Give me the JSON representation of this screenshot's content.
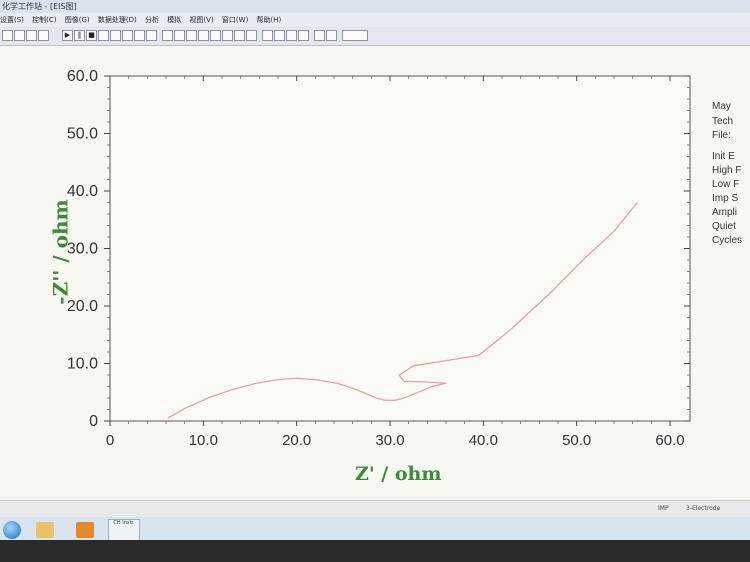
{
  "window": {
    "title": "化学工作站 - [EIS图]",
    "menus": [
      "设置(S)",
      "控制(C)",
      "图像(G)",
      "数据处理(D)",
      "分析",
      "模拟",
      "视图(V)",
      "窗口(W)",
      "帮助(H)"
    ]
  },
  "status": {
    "left_text": "",
    "mode": "IMP",
    "electrode": "3-Electrode"
  },
  "taskbar": {
    "app_label": "CH Instr."
  },
  "info_panel": {
    "lines": [
      "May",
      "Tech",
      "File:",
      "Init E",
      "High F",
      "Low F",
      "Imp S",
      "Ampli",
      "Quiet",
      "Cycles"
    ]
  },
  "chart_data": {
    "type": "line",
    "title": "",
    "xlabel": "Z' / ohm",
    "ylabel": "-Z'' / ohm",
    "xlim": [
      0,
      60
    ],
    "ylim": [
      0,
      60
    ],
    "xticks": [
      "0",
      "10.0",
      "20.0",
      "30.0",
      "40.0",
      "50.0",
      "60.0"
    ],
    "yticks": [
      "0",
      "10.0",
      "20.0",
      "30.0",
      "40.0",
      "50.0",
      "60.0"
    ],
    "grid": false,
    "series": [
      {
        "color": "#e8a0a0",
        "x": [
          6.2,
          8.0,
          10.5,
          13.0,
          15.5,
          18.0,
          20.0,
          22.0,
          24.5,
          26.5,
          28.5,
          29.5,
          30.5,
          31.5,
          33.0,
          34.5,
          36.0,
          33.5,
          31.5,
          31.0,
          32.5,
          36.0,
          39.5,
          43.0,
          47.0,
          51.0,
          54.0,
          56.5
        ],
        "y": [
          0.5,
          2.2,
          4.0,
          5.4,
          6.5,
          7.2,
          7.4,
          7.2,
          6.5,
          5.4,
          4.0,
          3.6,
          3.6,
          4.0,
          5.0,
          6.0,
          6.6,
          6.8,
          6.9,
          8.0,
          9.6,
          10.5,
          11.4,
          16.0,
          22.0,
          28.5,
          33.0,
          38.0
        ]
      }
    ]
  }
}
